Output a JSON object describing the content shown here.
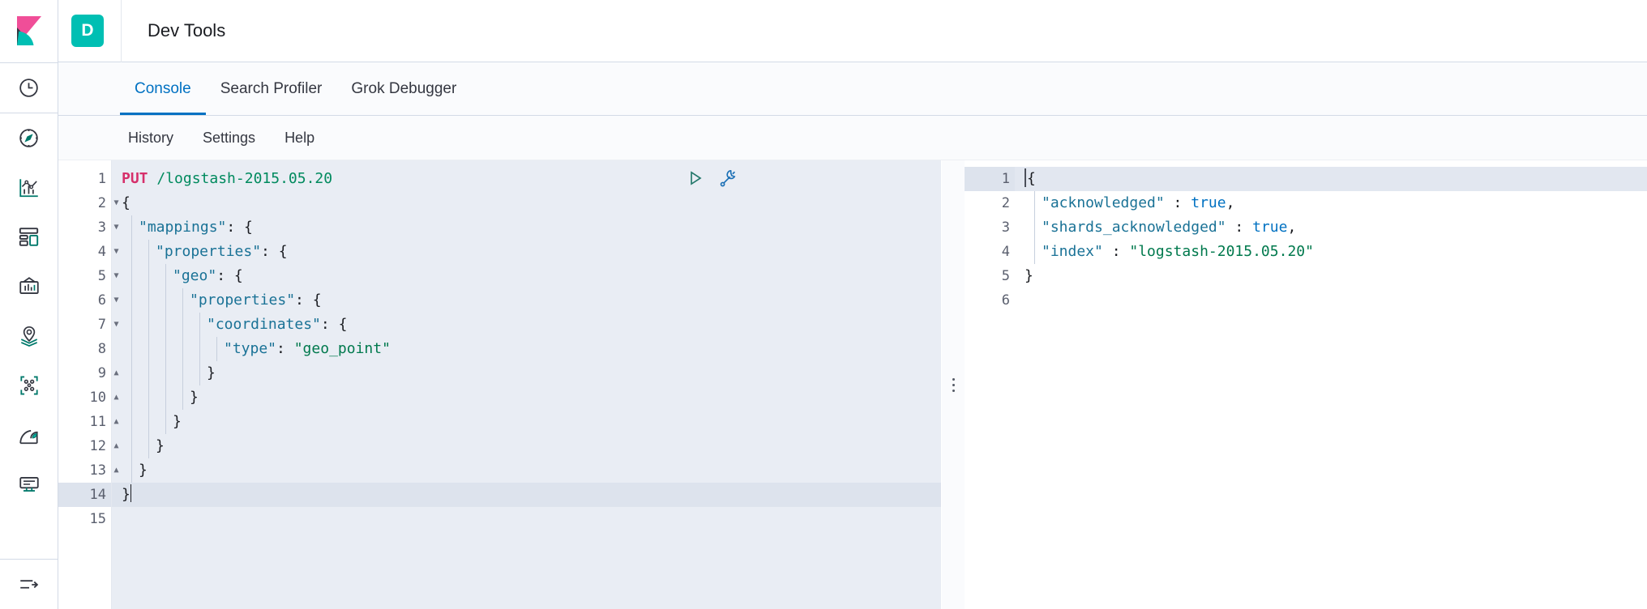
{
  "header": {
    "logo_icon": "kibana-logo-icon",
    "app_badge": "D",
    "title": "Dev Tools"
  },
  "sidebar": {
    "items": [
      {
        "icon": "recently-viewed-clock-icon",
        "label": ""
      },
      {
        "icon": "discover-compass-icon",
        "label": ""
      },
      {
        "icon": "visualize-chart-icon",
        "label": ""
      },
      {
        "icon": "dashboard-layout-icon",
        "label": ""
      },
      {
        "icon": "canvas-presentation-icon",
        "label": ""
      },
      {
        "icon": "maps-location-pin-icon",
        "label": ""
      },
      {
        "icon": "machine-learning-nodes-icon",
        "label": ""
      },
      {
        "icon": "infrastructure-monitoring-icon",
        "label": ""
      },
      {
        "icon": "logs-stream-icon",
        "label": ""
      }
    ],
    "collapse_icon": "collapse-arrow-icon"
  },
  "tabs": [
    {
      "label": "Console",
      "active": true
    },
    {
      "label": "Search Profiler",
      "active": false
    },
    {
      "label": "Grok Debugger",
      "active": false
    }
  ],
  "submenu": [
    {
      "label": "History"
    },
    {
      "label": "Settings"
    },
    {
      "label": "Help"
    }
  ],
  "editor_actions": [
    {
      "icon": "play-triangle-icon",
      "label": "Click to send request"
    },
    {
      "icon": "wrench-icon",
      "label": "Open documentation"
    }
  ],
  "request": {
    "line_count": 15,
    "active_line": 14,
    "fold_markers": {
      "2": "down",
      "3": "down",
      "4": "down",
      "5": "down",
      "6": "down",
      "7": "down",
      "9": "up",
      "10": "up",
      "11": "up",
      "12": "up",
      "13": "up",
      "14": "up"
    },
    "lines": [
      {
        "n": 1,
        "method": "PUT",
        "path": "/logstash-2015.05.20"
      },
      {
        "n": 2,
        "indent": 0,
        "text": "{"
      },
      {
        "n": 3,
        "indent": 1,
        "key": "\"mappings\"",
        "text": ": {"
      },
      {
        "n": 4,
        "indent": 2,
        "key": "\"properties\"",
        "text": ": {"
      },
      {
        "n": 5,
        "indent": 3,
        "key": "\"geo\"",
        "text": ": {"
      },
      {
        "n": 6,
        "indent": 4,
        "key": "\"properties\"",
        "text": ": {"
      },
      {
        "n": 7,
        "indent": 5,
        "key": "\"coordinates\"",
        "text": ": {"
      },
      {
        "n": 8,
        "indent": 6,
        "key": "\"type\"",
        "text": ": ",
        "value": "\"geo_point\""
      },
      {
        "n": 9,
        "indent": 5,
        "text": "}"
      },
      {
        "n": 10,
        "indent": 4,
        "text": "}"
      },
      {
        "n": 11,
        "indent": 3,
        "text": "}"
      },
      {
        "n": 12,
        "indent": 2,
        "text": "}"
      },
      {
        "n": 13,
        "indent": 1,
        "text": "}"
      },
      {
        "n": 14,
        "indent": 0,
        "text": "}",
        "cursor": true
      },
      {
        "n": 15,
        "indent": 0,
        "text": ""
      }
    ],
    "raw_text": "PUT /logstash-2015.05.20\n{\n  \"mappings\": {\n    \"properties\": {\n      \"geo\": {\n        \"properties\": {\n          \"coordinates\": {\n            \"type\": \"geo_point\"\n          }\n        }\n      }\n    }\n  }\n}\n"
  },
  "response": {
    "line_count": 6,
    "active_line": 1,
    "fold_markers": {
      "1": "down",
      "5": "up"
    },
    "lines": [
      {
        "n": 1,
        "indent": 0,
        "text": "{"
      },
      {
        "n": 2,
        "indent": 1,
        "key": "\"acknowledged\"",
        "sep": " : ",
        "bool": "true",
        "tail": ","
      },
      {
        "n": 3,
        "indent": 1,
        "key": "\"shards_acknowledged\"",
        "sep": " : ",
        "bool": "true",
        "tail": ","
      },
      {
        "n": 4,
        "indent": 1,
        "key": "\"index\"",
        "sep": " : ",
        "str": "\"logstash-2015.05.20\""
      },
      {
        "n": 5,
        "indent": 0,
        "text": "}"
      },
      {
        "n": 6,
        "indent": 0,
        "text": ""
      }
    ],
    "raw_text": "{\n  \"acknowledged\" : true,\n  \"shards_acknowledged\" : true,\n  \"index\" : \"logstash-2015.05.20\"\n}\n"
  },
  "colors": {
    "accent_blue": "#0071c2",
    "teal": "#00bfb3",
    "pink": "#f04e98",
    "method_pink": "#d6306b",
    "string_green": "#00794d",
    "key_blue": "#1a7296",
    "editor_bg": "#e9edf4",
    "border": "#d3dae6"
  }
}
